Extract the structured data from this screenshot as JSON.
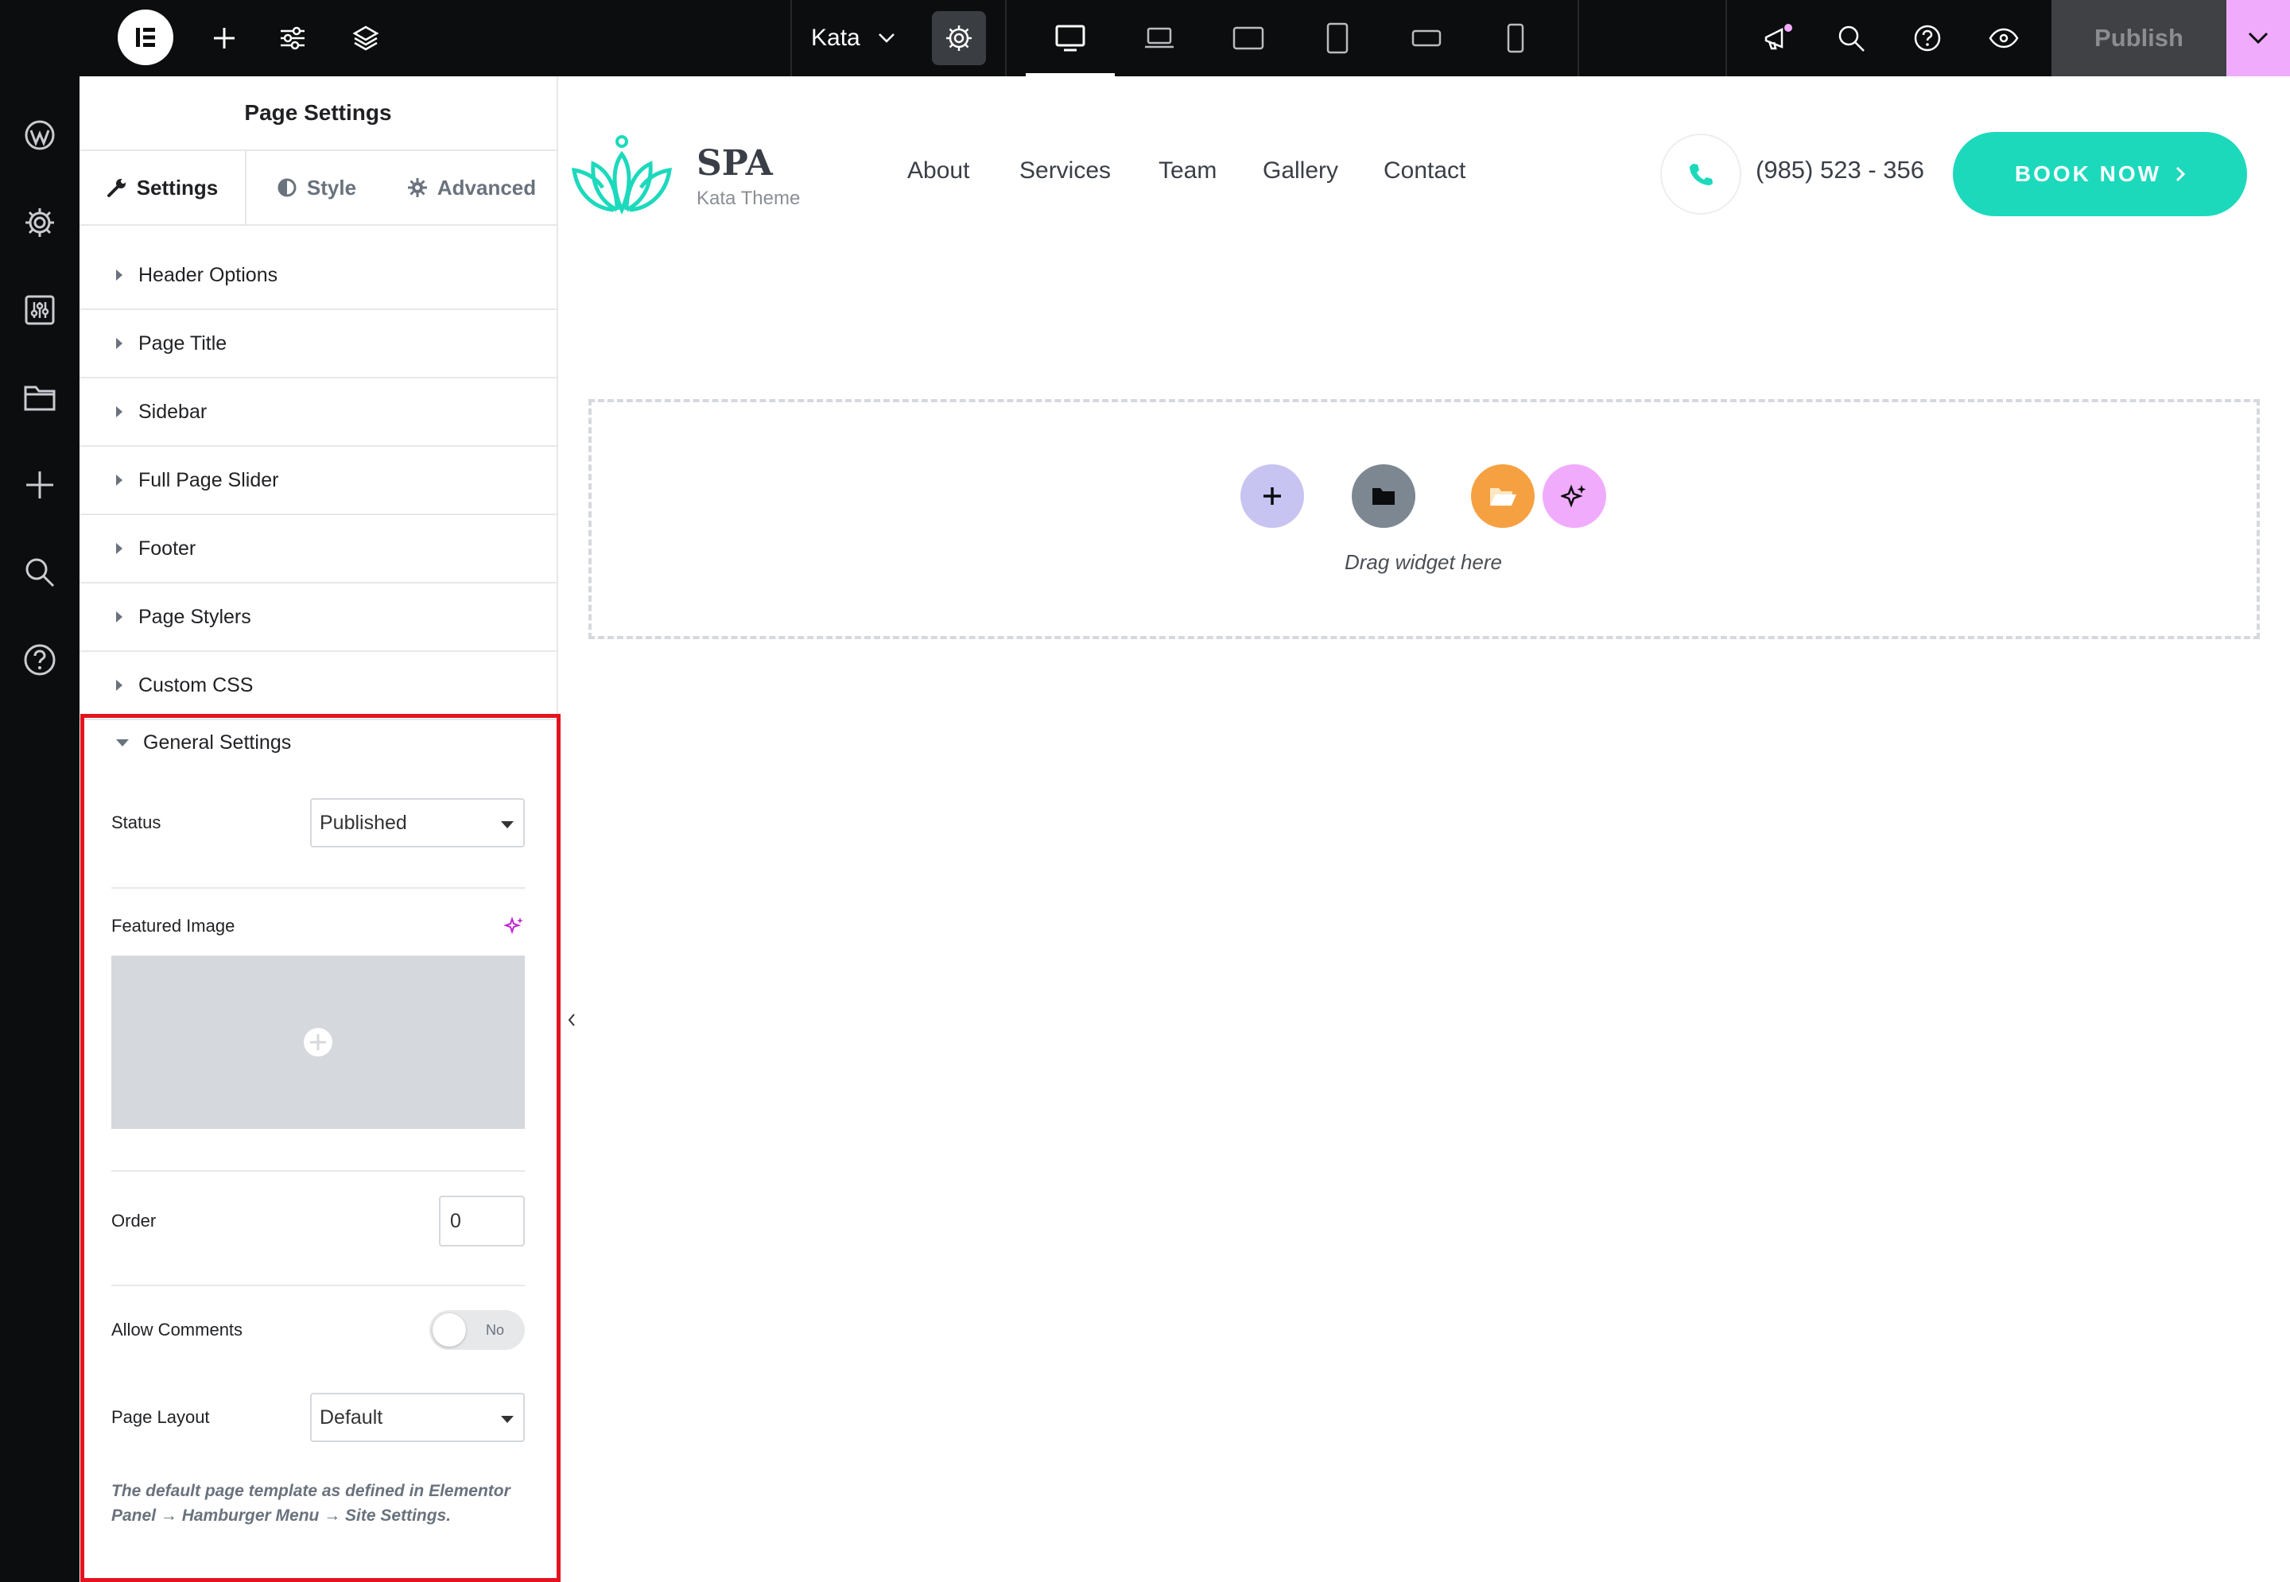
{
  "topbar": {
    "kit_name": "Kata",
    "publish_label": "Publish"
  },
  "panel": {
    "title": "Page Settings",
    "tabs": [
      {
        "label": "Settings"
      },
      {
        "label": "Style"
      },
      {
        "label": "Advanced"
      }
    ],
    "sections": [
      {
        "label": "Header Options"
      },
      {
        "label": "Page Title"
      },
      {
        "label": "Sidebar"
      },
      {
        "label": "Full Page Slider"
      },
      {
        "label": "Footer"
      },
      {
        "label": "Page Stylers"
      },
      {
        "label": "Custom CSS"
      }
    ],
    "general": {
      "title": "General Settings",
      "status_label": "Status",
      "status_value": "Published",
      "featured_label": "Featured Image",
      "order_label": "Order",
      "order_value": "0",
      "comments_label": "Allow Comments",
      "comments_toggle": "No",
      "layout_label": "Page Layout",
      "layout_value": "Default",
      "description": "The default page template as defined in Elementor Panel → Hamburger Menu → Site Settings."
    }
  },
  "site": {
    "logo_name": "SPA",
    "logo_tagline": "Kata Theme",
    "nav": [
      "About",
      "Services",
      "Team",
      "Gallery",
      "Contact"
    ],
    "phone": "(985) 523 - 356",
    "cta": "BOOK NOW",
    "drop_text": "Drag widget here"
  },
  "colors": {
    "accent": "#1cd9bc",
    "highlight": "#e3141f",
    "publish_more": "#f0abfc"
  }
}
